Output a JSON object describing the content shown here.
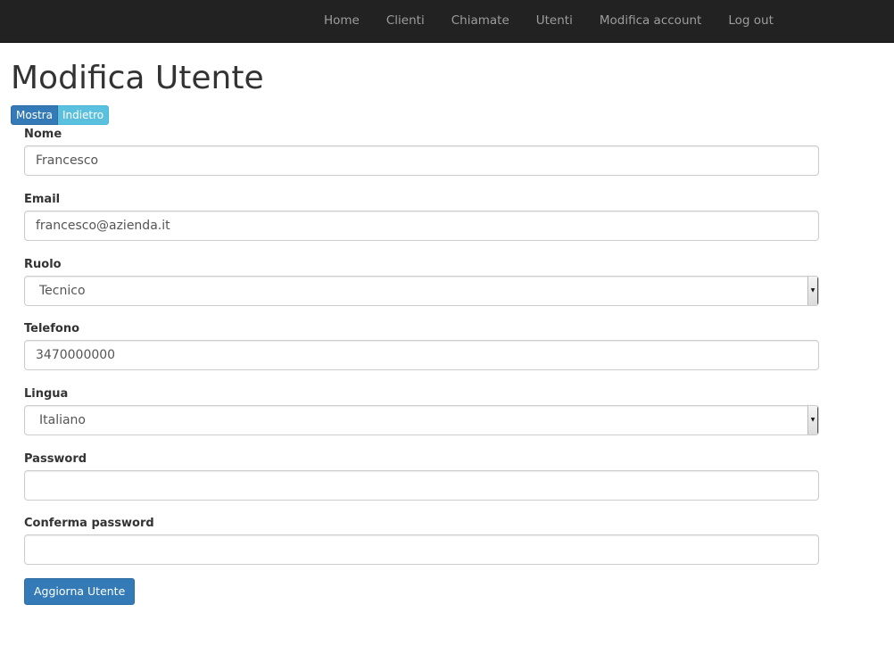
{
  "navbar": {
    "links": [
      {
        "label": "Home"
      },
      {
        "label": "Clienti"
      },
      {
        "label": "Chiamate"
      },
      {
        "label": "Utenti"
      },
      {
        "label": "Modifica account"
      },
      {
        "label": "Log out"
      }
    ]
  },
  "page": {
    "title": "Modifica Utente"
  },
  "actions": {
    "show_label": "Mostra",
    "back_label": "Indietro"
  },
  "form": {
    "nome": {
      "label": "Nome",
      "value": "Francesco"
    },
    "email": {
      "label": "Email",
      "value": "francesco@azienda.it"
    },
    "ruolo": {
      "label": "Ruolo",
      "value": "Tecnico"
    },
    "telefono": {
      "label": "Telefono",
      "value": "3470000000"
    },
    "lingua": {
      "label": "Lingua",
      "value": "Italiano"
    },
    "password": {
      "label": "Password",
      "value": ""
    },
    "conferma_password": {
      "label": "Conferma password",
      "value": ""
    },
    "submit_label": "Aggiorna Utente"
  },
  "colors": {
    "navbar_bg": "#222222",
    "primary": "#337ab7",
    "info": "#5bc0de"
  }
}
